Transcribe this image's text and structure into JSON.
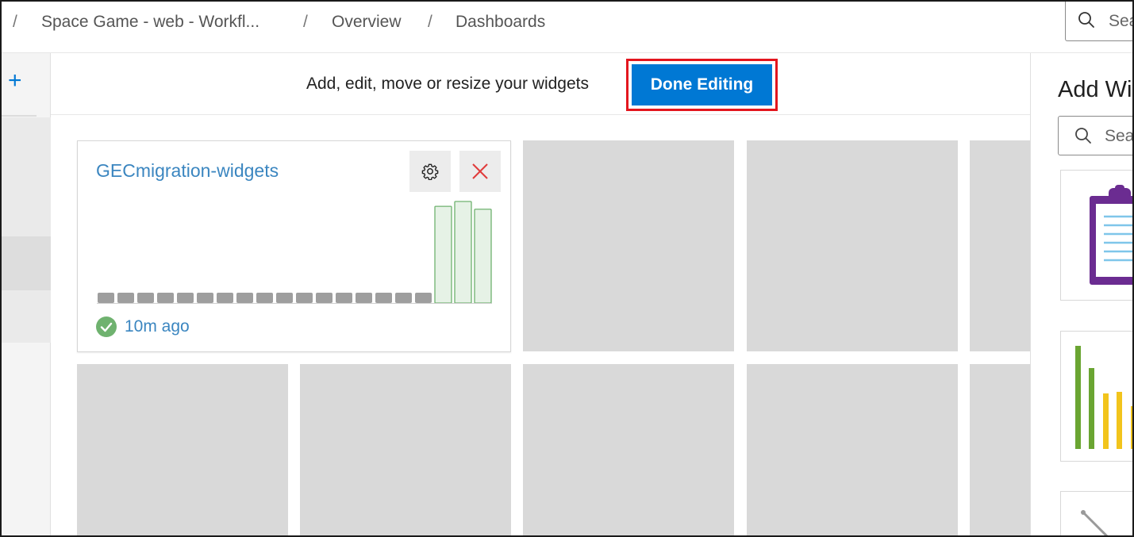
{
  "breadcrumb": {
    "separator": "/",
    "items": [
      "Space Game - web - Workfl...",
      "Overview",
      "Dashboards"
    ]
  },
  "top_search": {
    "placeholder": "Sea"
  },
  "left_rail": {
    "add_label": "+"
  },
  "edit_bar": {
    "message": "Add, edit, move or resize your widgets",
    "done_button": "Done Editing"
  },
  "widget": {
    "title": "GECmigration-widgets",
    "status_text": "10m ago",
    "status": "succeeded",
    "chart_data": {
      "type": "bar",
      "series": [
        {
          "name": "",
          "values": [
            0,
            0,
            0,
            0,
            0,
            0,
            0,
            0,
            0,
            0,
            0,
            0,
            0,
            0,
            0,
            0,
            0,
            1,
            1.05,
            0.97
          ]
        }
      ],
      "bar_states": [
        "none",
        "none",
        "none",
        "none",
        "none",
        "none",
        "none",
        "none",
        "none",
        "none",
        "none",
        "none",
        "none",
        "none",
        "none",
        "none",
        "none",
        "succeeded",
        "succeeded",
        "succeeded"
      ]
    }
  },
  "right_panel": {
    "title": "Add Wi",
    "search_placeholder": "Sea"
  },
  "colors": {
    "accent": "#0078d4",
    "highlight_border": "#e3161e",
    "success_green": "#6fb26f",
    "success_fill": "#e6f2e6",
    "empty_bar": "#9e9e9e",
    "placeholder_tile": "#d9d9d9",
    "link_blue": "#3b86c0"
  },
  "icons": {
    "search": "search-icon",
    "settings": "gear-icon",
    "close": "close-icon",
    "status": "check-circle-icon",
    "add": "plus-icon"
  }
}
